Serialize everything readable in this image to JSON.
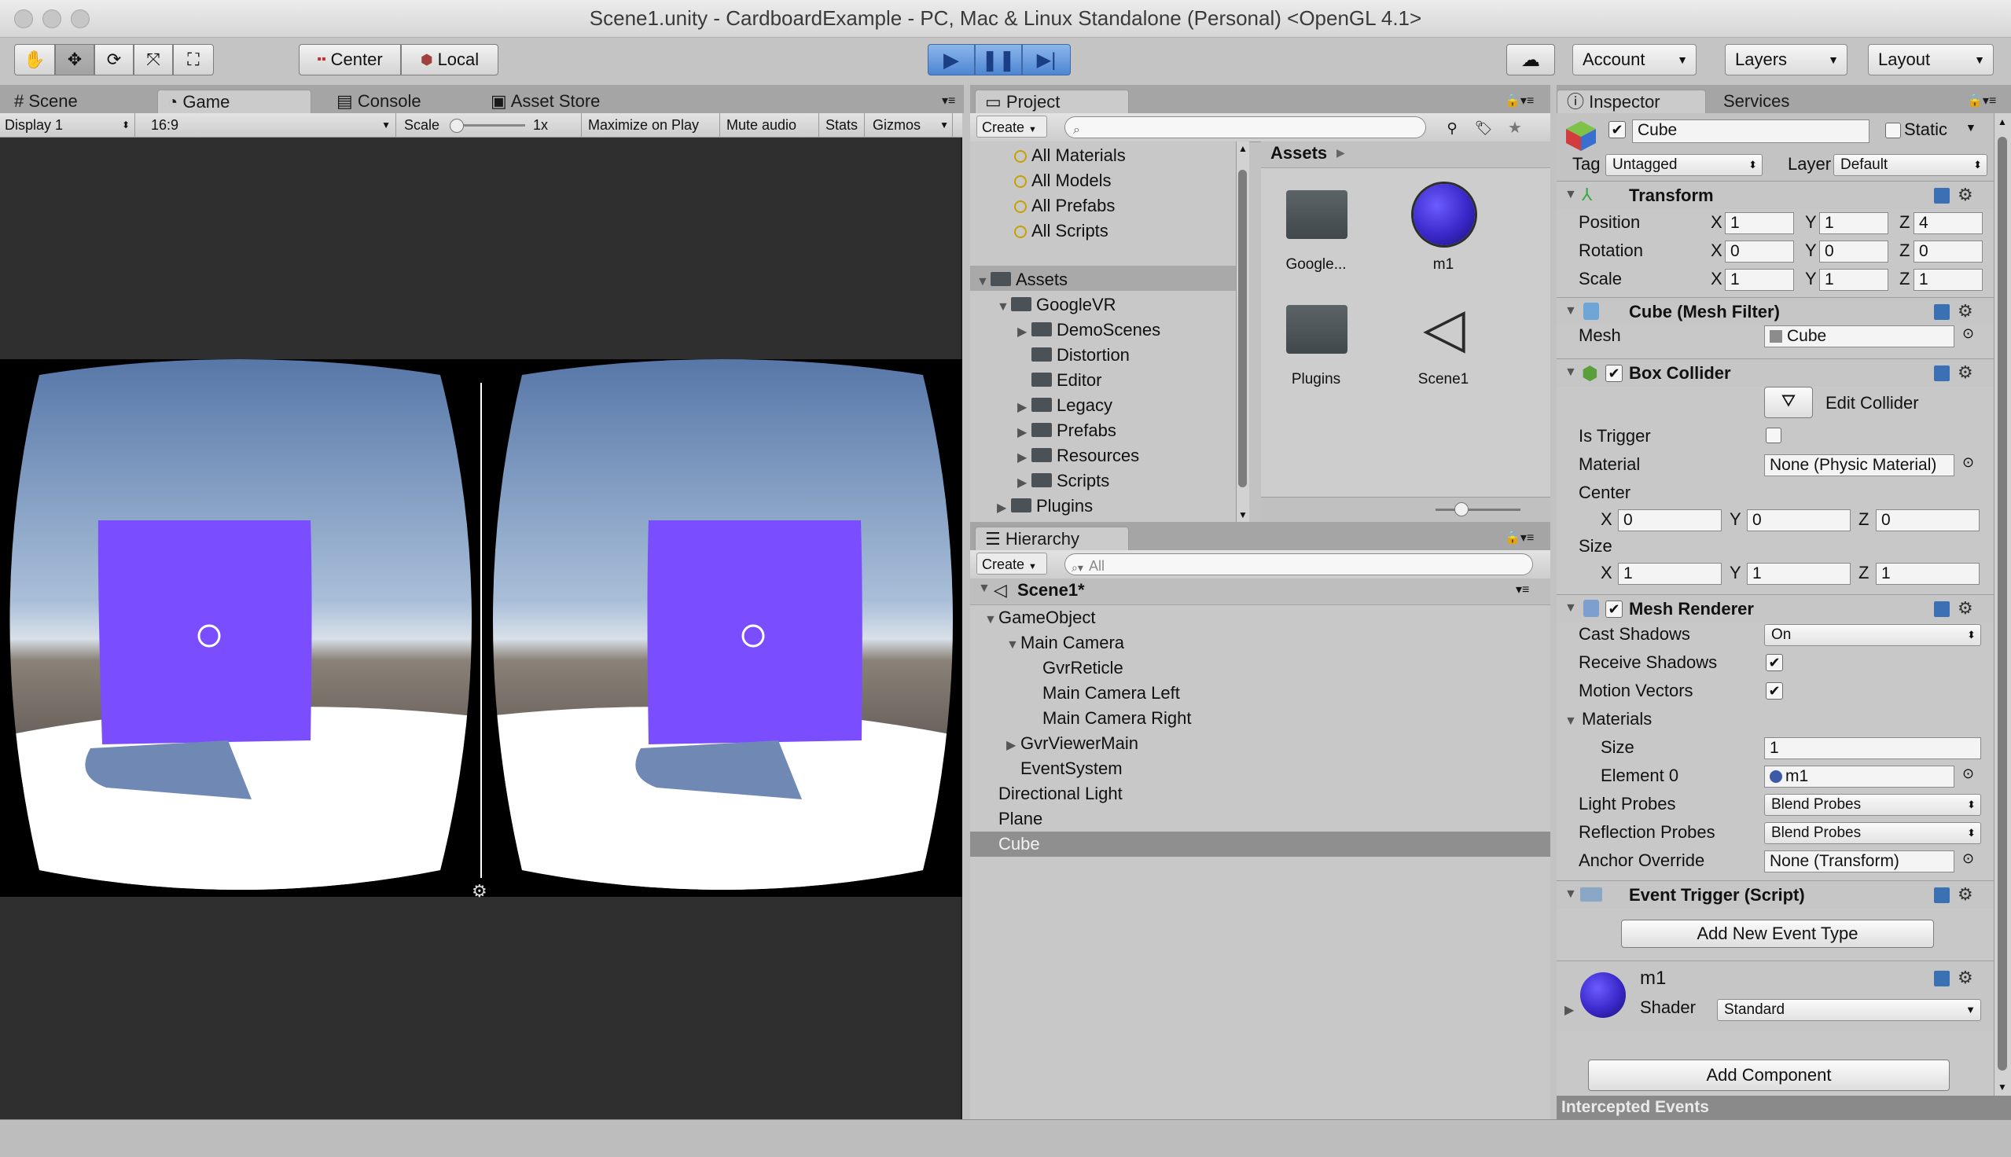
{
  "window": {
    "title": "Scene1.unity - CardboardExample - PC, Mac & Linux Standalone (Personal) <OpenGL 4.1>"
  },
  "toolbar": {
    "pivot_label": "Center",
    "space_label": "Local",
    "account_label": "Account",
    "layers_label": "Layers",
    "layout_label": "Layout"
  },
  "left_tabs": {
    "scene": "Scene",
    "game": "Game",
    "console": "Console",
    "asset_store": "Asset Store"
  },
  "game_bar": {
    "display": "Display 1",
    "aspect": "16:9",
    "scale_label": "Scale",
    "scale_value": "1x",
    "maximize": "Maximize on Play",
    "mute": "Mute audio",
    "stats": "Stats",
    "gizmos": "Gizmos"
  },
  "project": {
    "tab": "Project",
    "create": "Create",
    "search_placeholder": "",
    "favorites": [
      "All Materials",
      "All Models",
      "All Prefabs",
      "All Scripts"
    ],
    "tree": [
      {
        "label": "Assets",
        "depth": 0,
        "arrow": "open"
      },
      {
        "label": "GoogleVR",
        "depth": 1,
        "arrow": "open"
      },
      {
        "label": "DemoScenes",
        "depth": 2,
        "arrow": "closed"
      },
      {
        "label": "Distortion",
        "depth": 2,
        "arrow": "none"
      },
      {
        "label": "Editor",
        "depth": 2,
        "arrow": "none"
      },
      {
        "label": "Legacy",
        "depth": 2,
        "arrow": "closed"
      },
      {
        "label": "Prefabs",
        "depth": 2,
        "arrow": "closed"
      },
      {
        "label": "Resources",
        "depth": 2,
        "arrow": "closed"
      },
      {
        "label": "Scripts",
        "depth": 2,
        "arrow": "closed"
      },
      {
        "label": "Plugins",
        "depth": 1,
        "arrow": "closed"
      }
    ],
    "breadcrumb": "Assets",
    "assets": [
      {
        "label": "Google...",
        "kind": "folder"
      },
      {
        "label": "m1",
        "kind": "material"
      },
      {
        "label": "Plugins",
        "kind": "folder"
      },
      {
        "label": "Scene1",
        "kind": "scene"
      }
    ]
  },
  "hierarchy": {
    "tab": "Hierarchy",
    "create": "Create",
    "search_placeholder": "All",
    "scene": "Scene1*",
    "items": [
      {
        "label": "GameObject",
        "depth": 0,
        "arrow": "open"
      },
      {
        "label": "Main Camera",
        "depth": 1,
        "arrow": "open"
      },
      {
        "label": "GvrReticle",
        "depth": 2,
        "arrow": "none"
      },
      {
        "label": "Main Camera Left",
        "depth": 2,
        "arrow": "none"
      },
      {
        "label": "Main Camera Right",
        "depth": 2,
        "arrow": "none"
      },
      {
        "label": "GvrViewerMain",
        "depth": 1,
        "arrow": "closed"
      },
      {
        "label": "EventSystem",
        "depth": 1,
        "arrow": "none"
      },
      {
        "label": "Directional Light",
        "depth": 0,
        "arrow": "none"
      },
      {
        "label": "Plane",
        "depth": 0,
        "arrow": "none"
      },
      {
        "label": "Cube",
        "depth": 0,
        "arrow": "none",
        "selected": true
      }
    ]
  },
  "inspector": {
    "tab": "Inspector",
    "services_tab": "Services",
    "object_name": "Cube",
    "static_label": "Static",
    "tag_label": "Tag",
    "tag_value": "Untagged",
    "layer_label": "Layer",
    "layer_value": "Default",
    "transform": {
      "title": "Transform",
      "position_label": "Position",
      "position": {
        "x": "1",
        "y": "1",
        "z": "4"
      },
      "rotation_label": "Rotation",
      "rotation": {
        "x": "0",
        "y": "0",
        "z": "0"
      },
      "scale_label": "Scale",
      "scale": {
        "x": "1",
        "y": "1",
        "z": "1"
      }
    },
    "mesh_filter": {
      "title": "Cube (Mesh Filter)",
      "mesh_label": "Mesh",
      "mesh_value": "Cube"
    },
    "box_collider": {
      "title": "Box Collider",
      "edit_collider": "Edit Collider",
      "is_trigger_label": "Is Trigger",
      "material_label": "Material",
      "material_value": "None (Physic Material)",
      "center_label": "Center",
      "center": {
        "x": "0",
        "y": "0",
        "z": "0"
      },
      "size_label": "Size",
      "size": {
        "x": "1",
        "y": "1",
        "z": "1"
      }
    },
    "mesh_renderer": {
      "title": "Mesh Renderer",
      "cast_shadows_label": "Cast Shadows",
      "cast_shadows_value": "On",
      "receive_shadows_label": "Receive Shadows",
      "motion_vectors_label": "Motion Vectors",
      "materials_label": "Materials",
      "size_label": "Size",
      "size_value": "1",
      "element0_label": "Element 0",
      "element0_value": "m1",
      "light_probes_label": "Light Probes",
      "light_probes_value": "Blend Probes",
      "reflection_probes_label": "Reflection Probes",
      "reflection_probes_value": "Blend Probes",
      "anchor_override_label": "Anchor Override",
      "anchor_override_value": "None (Transform)"
    },
    "event_trigger": {
      "title": "Event Trigger (Script)",
      "add_button": "Add New Event Type"
    },
    "material": {
      "name": "m1",
      "shader_label": "Shader",
      "shader_value": "Standard"
    },
    "add_component": "Add Component",
    "intercepted_events": "Intercepted Events"
  },
  "colors": {
    "accent_blue": "#4d86d3",
    "cube_purple": "#7a4dff",
    "material_ball": "#3a28c9"
  }
}
